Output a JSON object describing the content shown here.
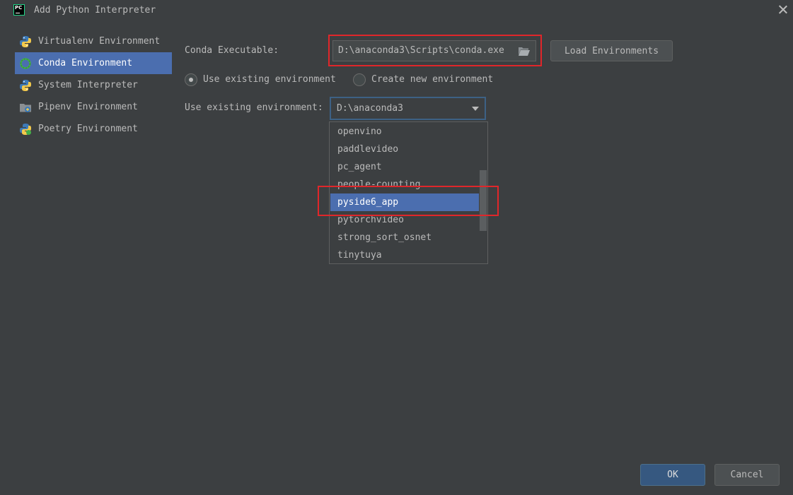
{
  "window": {
    "title": "Add Python Interpreter",
    "app_icon_text": "PC"
  },
  "sidebar": {
    "items": [
      {
        "label": "Virtualenv Environment",
        "icon": "python-icon"
      },
      {
        "label": "Conda Environment",
        "icon": "conda-icon",
        "selected": true
      },
      {
        "label": "System Interpreter",
        "icon": "python-icon"
      },
      {
        "label": "Pipenv Environment",
        "icon": "pipenv-icon"
      },
      {
        "label": "Poetry Environment",
        "icon": "poetry-icon"
      }
    ]
  },
  "conda": {
    "executable_label": "Conda Executable:",
    "executable_value": "D:\\anaconda3\\Scripts\\conda.exe",
    "load_button": "Load Environments"
  },
  "radios": {
    "use_existing": "Use existing environment",
    "create_new": "Create new environment",
    "selected": "use_existing"
  },
  "existing_env": {
    "label": "Use existing environment:",
    "value": "D:\\anaconda3",
    "options": [
      "openvino",
      "paddlevideo",
      "pc_agent",
      "people-counting",
      "pyside6_app",
      "pytorchvideo",
      "strong_sort_osnet",
      "tinytuya"
    ],
    "highlighted": "pyside6_app"
  },
  "footer": {
    "ok": "OK",
    "cancel": "Cancel"
  },
  "colors": {
    "accent": "#4b6eaf",
    "highlight_box": "#e0262a",
    "background": "#3c3f41"
  }
}
